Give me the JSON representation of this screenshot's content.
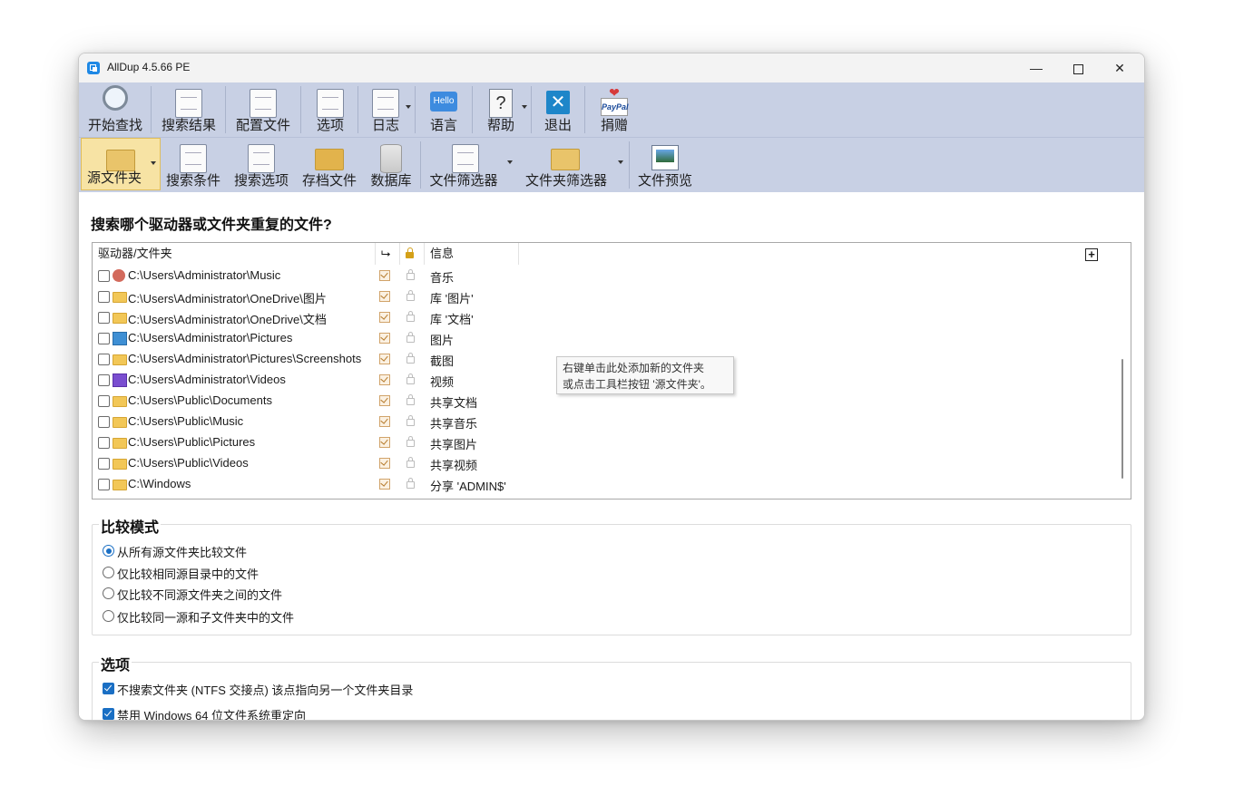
{
  "window": {
    "title": "AllDup 4.5.66 PE"
  },
  "toolbar_main": [
    {
      "label": "开始查找",
      "icon": "magnifier-icon"
    },
    {
      "label": "搜索结果",
      "icon": "results-list-icon"
    },
    {
      "label": "配置文件",
      "icon": "profile-gear-icon"
    },
    {
      "label": "选项",
      "icon": "options-gear-icon"
    },
    {
      "label": "日志",
      "icon": "log-icon"
    },
    {
      "label": "语言",
      "icon": "hello-language-icon",
      "icon_text": "Hello"
    },
    {
      "label": "帮助",
      "icon": "help-question-icon",
      "icon_text": "?"
    },
    {
      "label": "退出",
      "icon": "exit-x-icon",
      "icon_text": "✕"
    },
    {
      "label": "捐赠",
      "icon": "paypal-donate-icon",
      "icon_text": "PayPal"
    }
  ],
  "toolbar_sub": [
    {
      "label": "源文件夹",
      "icon": "source-folder-icon"
    },
    {
      "label": "搜索条件",
      "icon": "search-criteria-icon"
    },
    {
      "label": "搜索选项",
      "icon": "search-options-icon"
    },
    {
      "label": "存档文件",
      "icon": "archive-files-icon"
    },
    {
      "label": "数据库",
      "icon": "database-icon"
    },
    {
      "label": "文件筛选器",
      "icon": "file-filter-icon"
    },
    {
      "label": "文件夹筛选器",
      "icon": "folder-filter-icon"
    },
    {
      "label": "文件预览",
      "icon": "file-preview-icon"
    }
  ],
  "page": {
    "heading": "搜索哪个驱动器或文件夹重复的文件?"
  },
  "folder_list": {
    "columns": {
      "folder": "驱动器/文件夹",
      "subfolders": "⮡",
      "info": "信息"
    },
    "rows": [
      {
        "path": "C:\\Users\\Administrator\\Music",
        "info": "音乐",
        "icon": "music"
      },
      {
        "path": "C:\\Users\\Administrator\\OneDrive\\图片",
        "info": "库 '图片'",
        "icon": "folder"
      },
      {
        "path": "C:\\Users\\Administrator\\OneDrive\\文档",
        "info": "库 '文档'",
        "icon": "folder"
      },
      {
        "path": "C:\\Users\\Administrator\\Pictures",
        "info": "图片",
        "icon": "pictures"
      },
      {
        "path": "C:\\Users\\Administrator\\Pictures\\Screenshots",
        "info": "截图",
        "icon": "folder"
      },
      {
        "path": "C:\\Users\\Administrator\\Videos",
        "info": "视频",
        "icon": "videos"
      },
      {
        "path": "C:\\Users\\Public\\Documents",
        "info": "共享文档",
        "icon": "folder"
      },
      {
        "path": "C:\\Users\\Public\\Music",
        "info": "共享音乐",
        "icon": "folder"
      },
      {
        "path": "C:\\Users\\Public\\Pictures",
        "info": "共享图片",
        "icon": "folder"
      },
      {
        "path": "C:\\Users\\Public\\Videos",
        "info": "共享视频",
        "icon": "folder"
      },
      {
        "path": "C:\\Windows",
        "info": "分享 'ADMIN$'",
        "icon": "folder"
      }
    ],
    "tooltip": {
      "line1": "右键单击此处添加新的文件夹",
      "line2": "或点击工具栏按钮 '源文件夹'。"
    }
  },
  "compare_mode": {
    "title": "比较模式",
    "options": [
      {
        "label": "从所有源文件夹比较文件",
        "selected": true
      },
      {
        "label": "仅比较相同源目录中的文件",
        "selected": false
      },
      {
        "label": "仅比较不同源文件夹之间的文件",
        "selected": false
      },
      {
        "label": "仅比较同一源和子文件夹中的文件",
        "selected": false
      }
    ]
  },
  "options": {
    "title": "选项",
    "items": [
      {
        "label": "不搜索文件夹 (NTFS 交接点) 该点指向另一个文件夹目录",
        "checked": true
      },
      {
        "label": "禁用 Windows 64 位文件系统重定向",
        "checked": true
      }
    ]
  }
}
